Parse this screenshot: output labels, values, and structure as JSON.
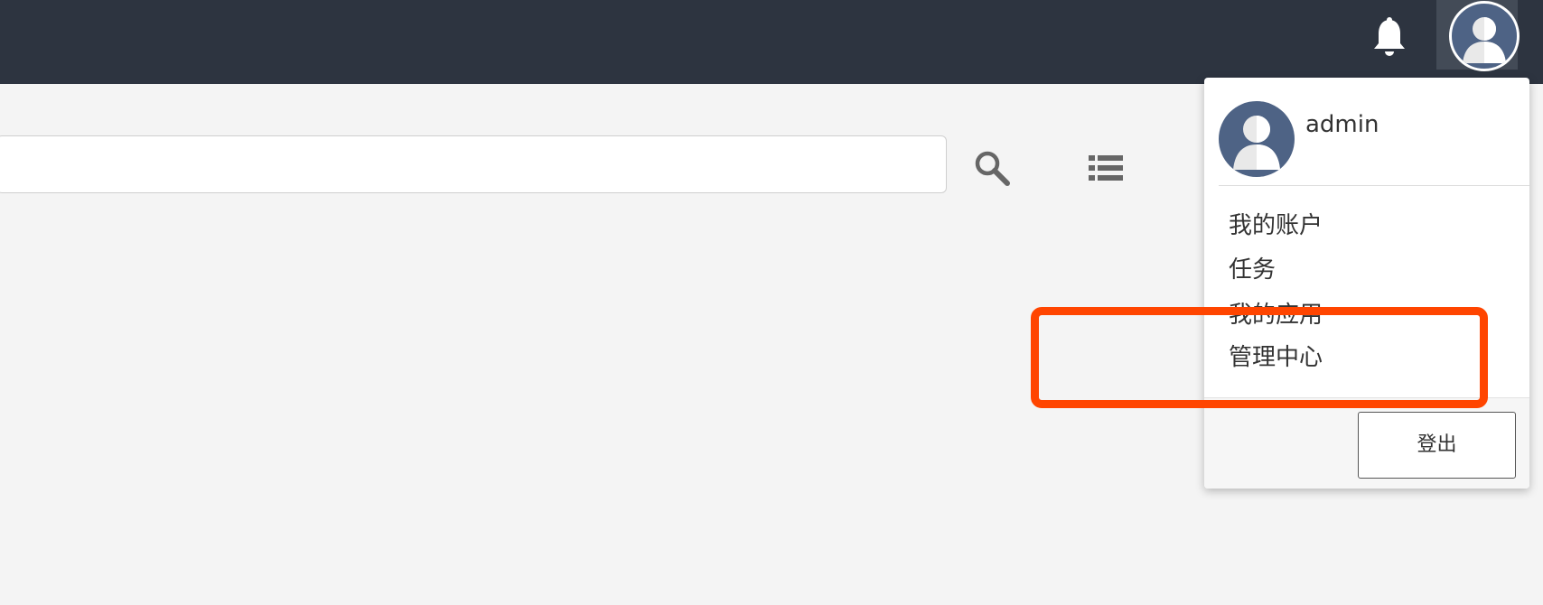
{
  "header": {
    "notifications_icon": "bell-icon",
    "user_avatar_icon": "user-avatar-icon"
  },
  "search": {
    "value": "",
    "placeholder": "",
    "search_icon": "search-icon",
    "list_icon": "list-view-icon"
  },
  "user_menu": {
    "username": "admin",
    "items": [
      {
        "label": "我的账户"
      },
      {
        "label": "任务"
      },
      {
        "label": "我的应用"
      },
      {
        "label": "管理中心"
      }
    ],
    "logout_label": "登出"
  },
  "colors": {
    "topbar": "#2d3440",
    "avatar": "#4e6385",
    "annotation": "#ff4500"
  }
}
